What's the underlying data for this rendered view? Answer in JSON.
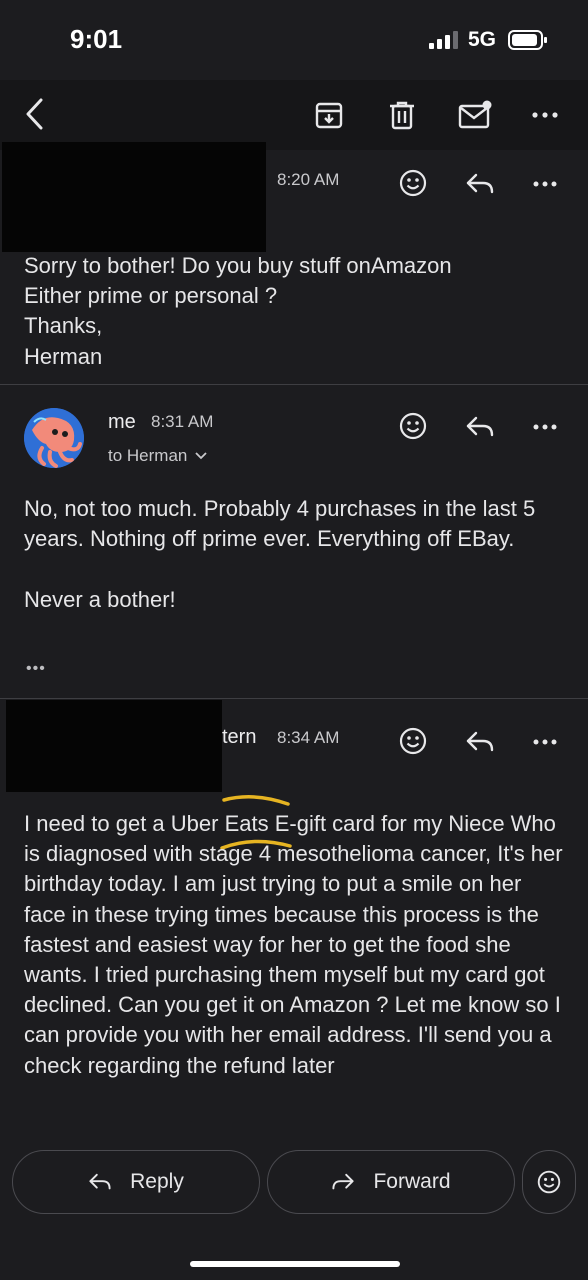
{
  "status_bar": {
    "time": "9:01",
    "network": "5G"
  },
  "toolbar": {
    "back_icon": "chevron-left-icon",
    "archive_icon": "archive-icon",
    "delete_icon": "trash-icon",
    "mark_unread_icon": "mail-unread-icon",
    "more_icon": "more-horizontal-icon"
  },
  "messages": [
    {
      "sender": "",
      "time": "8:20 AM",
      "body": "Sorry to bother! Do you buy stuff onAmazon\nEither prime or personal ?\nThanks,\nHerman"
    },
    {
      "sender": "me",
      "time": "8:31 AM",
      "recipient": "to Herman",
      "body": "No, not too much. Probably 4 purchases in the last 5 years. Nothing off prime ever. Everything off EBay.\n\nNever a bother!",
      "trimmed_indicator": "•••"
    },
    {
      "sender": "tern",
      "time": "8:34 AM",
      "body": "I need to get a Uber Eats E-gift card for my Niece Who is diagnosed with stage 4 mesothelioma cancer, It's her birthday today. I am just trying to put a smile on her face in these trying times because this process is the fastest and easiest way for her to get the food she wants. I tried purchasing them myself but my card got declined. Can you get it on Amazon ? Let me know so I can provide you with her email address. I'll send you a check regarding the refund later"
    }
  ],
  "actions": {
    "reply_label": "Reply",
    "forward_label": "Forward"
  },
  "colors": {
    "background": "#1c1c1f",
    "highlight_mark": "#e6b422",
    "avatar_bg": "#2f6fd6"
  }
}
